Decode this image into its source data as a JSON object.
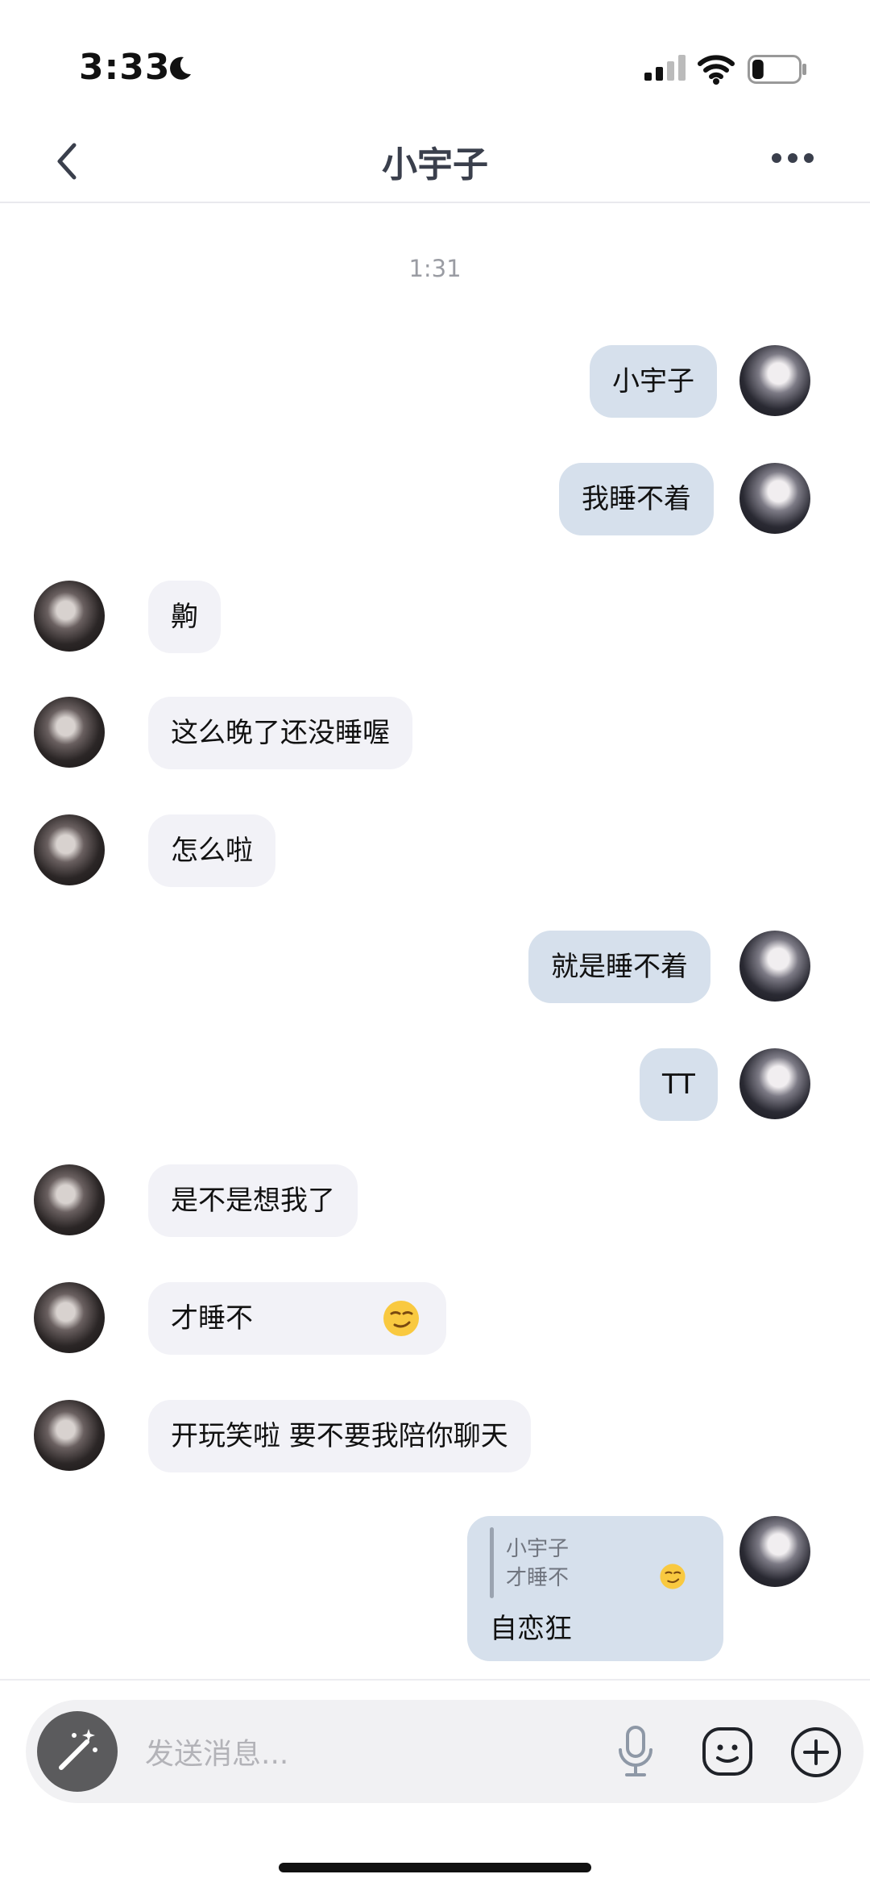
{
  "status_bar": {
    "time": "3:33",
    "battery_level": 0.25
  },
  "header": {
    "title": "小宇子",
    "back_icon": "chevron-left-icon",
    "more_icon": "more-dots-icon"
  },
  "chat": {
    "timestamp": "1:31",
    "messages": [
      {
        "side": "me",
        "text": "小宇子"
      },
      {
        "side": "me",
        "text": "我睡不着"
      },
      {
        "side": "them",
        "text": "齁"
      },
      {
        "side": "them",
        "text": "这么晚了还没睡喔"
      },
      {
        "side": "them",
        "text": "怎么啦"
      },
      {
        "side": "me",
        "text": "就是睡不着"
      },
      {
        "side": "me",
        "text": "TT"
      },
      {
        "side": "them",
        "text": "是不是想我了"
      },
      {
        "side": "them",
        "text": "才睡不",
        "emoji": "smirk-emoji"
      },
      {
        "side": "them",
        "text": "开玩笑啦 要不要我陪你聊天"
      }
    ],
    "reply_message": {
      "side": "me",
      "quote_name": "小宇子",
      "quote_text": "才睡不",
      "quote_emoji": "smirk-emoji",
      "text": "自恋狂"
    }
  },
  "input_bar": {
    "placeholder": "发送消息...",
    "icons": [
      "magic-wand-icon",
      "microphone-icon",
      "emoji-face-icon",
      "plus-circle-icon"
    ]
  },
  "colors": {
    "my_bubble": "#d6e0ec",
    "their_bubble": "#f2f2f7",
    "title": "#3a3f4c"
  }
}
